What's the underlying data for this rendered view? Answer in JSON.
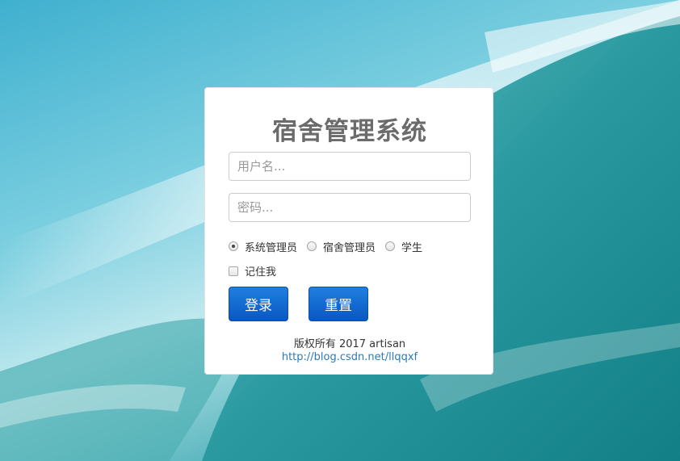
{
  "login": {
    "title": "宿舍管理系统",
    "username_placeholder": "用户名...",
    "password_placeholder": "密码...",
    "roles": [
      {
        "label": "系统管理员",
        "checked": true
      },
      {
        "label": "宿舍管理员",
        "checked": false
      },
      {
        "label": "学生",
        "checked": false
      }
    ],
    "remember_label": "记住我",
    "login_button": "登录",
    "reset_button": "重置",
    "copyright": "版权所有 2017 artisan",
    "link": "http://blog.csdn.net/llqqxf"
  },
  "colors": {
    "button": "#0a57c2",
    "link": "#2a7ab8",
    "title": "#6b6b6b"
  }
}
